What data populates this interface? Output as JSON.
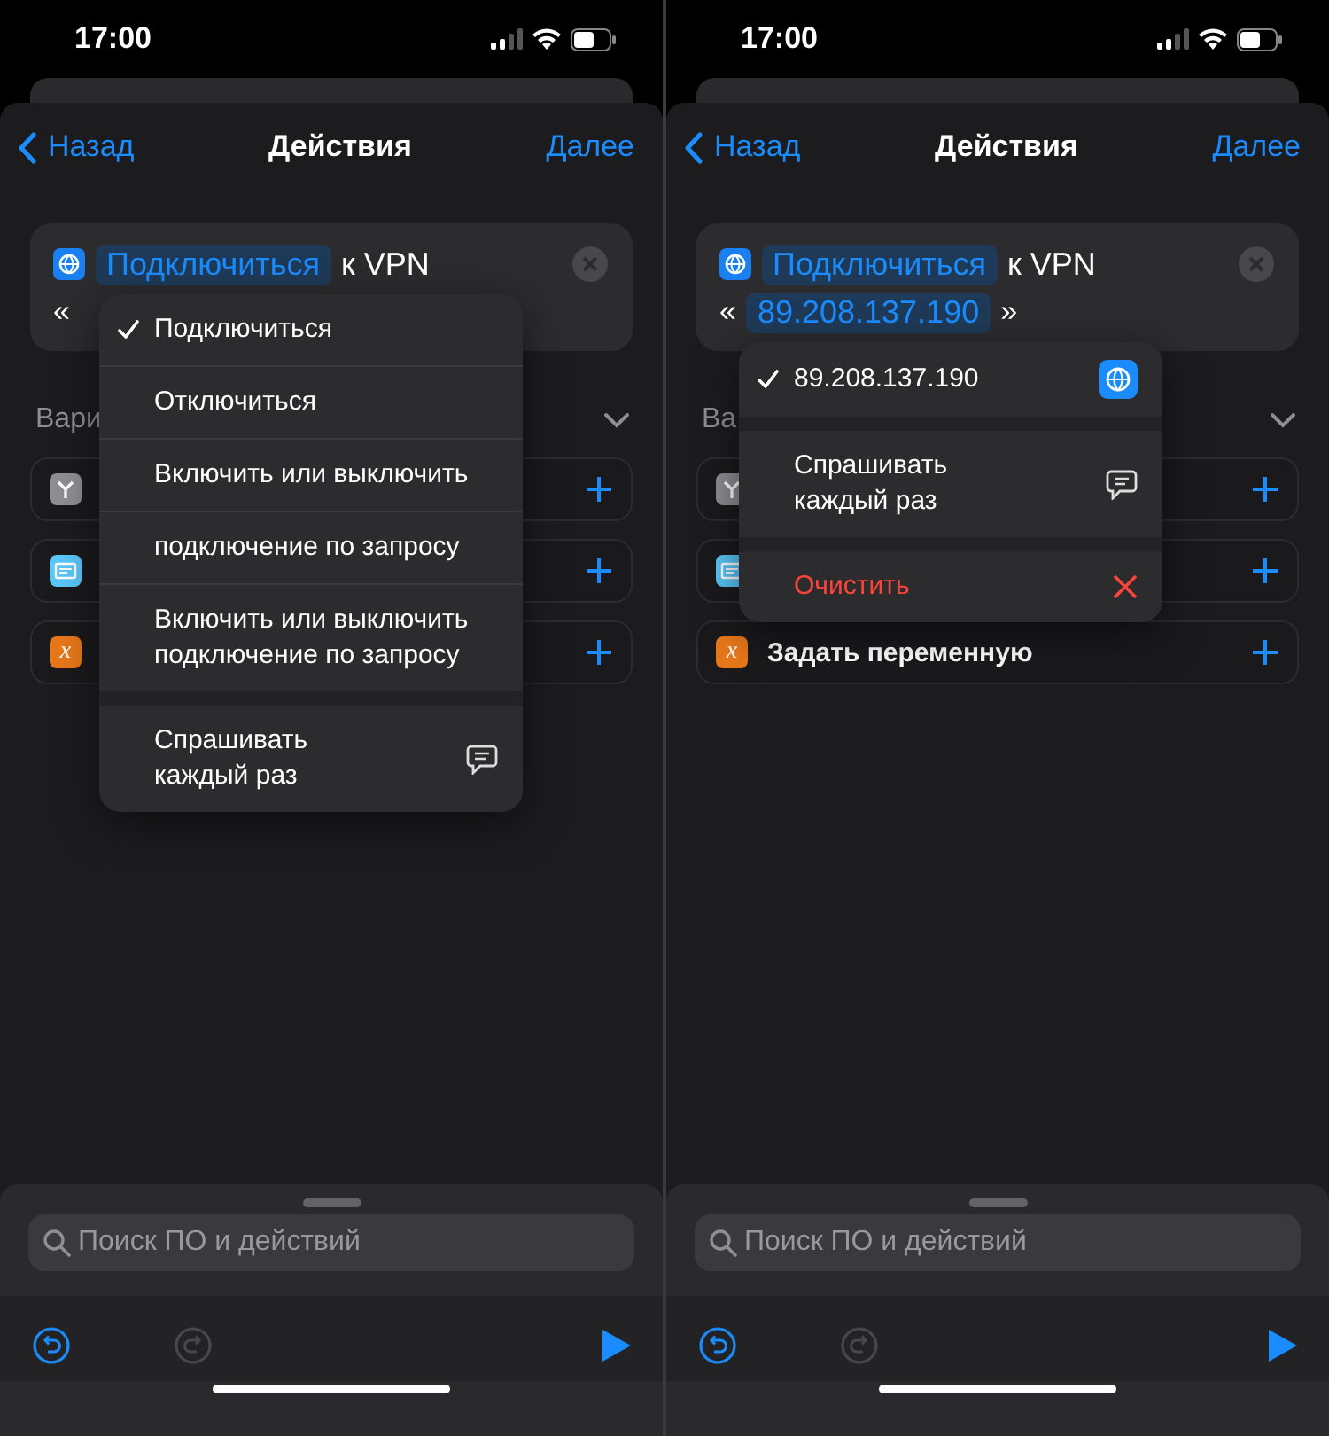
{
  "panels": [
    {
      "status": {
        "time": "17:00"
      },
      "nav": {
        "back": "Назад",
        "title": "Действия",
        "next": "Далее"
      },
      "action": {
        "token": "Подключиться",
        "text": "к VPN",
        "open_quote": "«"
      },
      "section": {
        "label": "Вари"
      },
      "suggestions": [
        {
          "kind": "if"
        },
        {
          "kind": "text"
        },
        {
          "kind": "variable",
          "glyph": "x"
        }
      ],
      "menu": {
        "groups": [
          [
            {
              "kind": "option",
              "label": "Подключиться",
              "selected": true
            },
            {
              "kind": "option",
              "label": "Отключиться",
              "selected": false
            },
            {
              "kind": "option",
              "label": "Включить или выключить",
              "selected": false
            },
            {
              "kind": "option",
              "label": "подключение по запросу",
              "selected": false
            },
            {
              "kind": "option",
              "label": "Включить или выключить\nподключение по запросу",
              "selected": false
            }
          ],
          [
            {
              "kind": "ask",
              "label": "Спрашивать\nкаждый раз",
              "selected": false
            }
          ]
        ]
      },
      "search": {
        "placeholder": "Поиск ПО и действий"
      }
    },
    {
      "status": {
        "time": "17:00"
      },
      "nav": {
        "back": "Назад",
        "title": "Действия",
        "next": "Далее"
      },
      "action": {
        "token": "Подключиться",
        "text": "к VPN",
        "open_quote": "«",
        "value_token": "89.208.137.190",
        "close_quote": "»"
      },
      "section": {
        "label": "Ва"
      },
      "suggestions": [
        {
          "kind": "if"
        },
        {
          "kind": "text"
        },
        {
          "kind": "variable",
          "glyph": "x",
          "label": "Задать переменную"
        }
      ],
      "menu": {
        "groups": [
          [
            {
              "kind": "value",
              "label": "89.208.137.190",
              "selected": true
            }
          ],
          [
            {
              "kind": "ask",
              "label": "Спрашивать\nкаждый раз",
              "selected": false
            }
          ],
          [
            {
              "kind": "clear",
              "label": "Очистить",
              "selected": false
            }
          ]
        ]
      },
      "search": {
        "placeholder": "Поиск ПО и действий"
      }
    }
  ]
}
